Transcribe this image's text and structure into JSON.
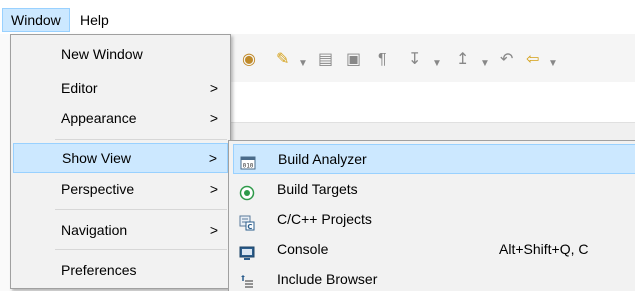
{
  "menubar": {
    "items": [
      {
        "label": "Window",
        "active": true
      },
      {
        "label": "Help",
        "active": false
      }
    ]
  },
  "window_menu": {
    "items": [
      {
        "label": "New Window",
        "has_submenu": false
      },
      {
        "label": "Editor",
        "has_submenu": true
      },
      {
        "label": "Appearance",
        "has_submenu": true
      },
      {
        "label": "Show View",
        "has_submenu": true,
        "highlighted": true
      },
      {
        "label": "Perspective",
        "has_submenu": true
      },
      {
        "label": "Navigation",
        "has_submenu": true
      },
      {
        "label": "Preferences",
        "has_submenu": false
      }
    ],
    "submenu_arrow": ">"
  },
  "show_view_submenu": {
    "items": [
      {
        "label": "Build Analyzer",
        "icon": "build-analyzer-icon",
        "shortcut": "",
        "highlighted": true
      },
      {
        "label": "Build Targets",
        "icon": "build-targets-icon",
        "shortcut": ""
      },
      {
        "label": "C/C++ Projects",
        "icon": "cpp-projects-icon",
        "shortcut": ""
      },
      {
        "label": "Console",
        "icon": "console-icon",
        "shortcut": "Alt+Shift+Q, C"
      },
      {
        "label": "Include Browser",
        "icon": "include-browser-icon",
        "shortcut": ""
      }
    ]
  },
  "colors": {
    "highlight_bg": "#cce8ff",
    "highlight_border": "#99d1ff",
    "menu_bg": "#f2f2f2"
  }
}
